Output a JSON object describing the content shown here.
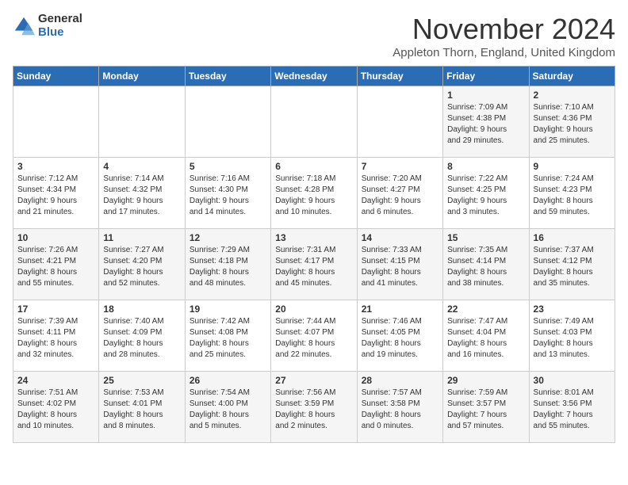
{
  "logo": {
    "general": "General",
    "blue": "Blue"
  },
  "title": "November 2024",
  "location": "Appleton Thorn, England, United Kingdom",
  "days_of_week": [
    "Sunday",
    "Monday",
    "Tuesday",
    "Wednesday",
    "Thursday",
    "Friday",
    "Saturday"
  ],
  "weeks": [
    [
      {
        "day": "",
        "info": ""
      },
      {
        "day": "",
        "info": ""
      },
      {
        "day": "",
        "info": ""
      },
      {
        "day": "",
        "info": ""
      },
      {
        "day": "",
        "info": ""
      },
      {
        "day": "1",
        "info": "Sunrise: 7:09 AM\nSunset: 4:38 PM\nDaylight: 9 hours\nand 29 minutes."
      },
      {
        "day": "2",
        "info": "Sunrise: 7:10 AM\nSunset: 4:36 PM\nDaylight: 9 hours\nand 25 minutes."
      }
    ],
    [
      {
        "day": "3",
        "info": "Sunrise: 7:12 AM\nSunset: 4:34 PM\nDaylight: 9 hours\nand 21 minutes."
      },
      {
        "day": "4",
        "info": "Sunrise: 7:14 AM\nSunset: 4:32 PM\nDaylight: 9 hours\nand 17 minutes."
      },
      {
        "day": "5",
        "info": "Sunrise: 7:16 AM\nSunset: 4:30 PM\nDaylight: 9 hours\nand 14 minutes."
      },
      {
        "day": "6",
        "info": "Sunrise: 7:18 AM\nSunset: 4:28 PM\nDaylight: 9 hours\nand 10 minutes."
      },
      {
        "day": "7",
        "info": "Sunrise: 7:20 AM\nSunset: 4:27 PM\nDaylight: 9 hours\nand 6 minutes."
      },
      {
        "day": "8",
        "info": "Sunrise: 7:22 AM\nSunset: 4:25 PM\nDaylight: 9 hours\nand 3 minutes."
      },
      {
        "day": "9",
        "info": "Sunrise: 7:24 AM\nSunset: 4:23 PM\nDaylight: 8 hours\nand 59 minutes."
      }
    ],
    [
      {
        "day": "10",
        "info": "Sunrise: 7:26 AM\nSunset: 4:21 PM\nDaylight: 8 hours\nand 55 minutes."
      },
      {
        "day": "11",
        "info": "Sunrise: 7:27 AM\nSunset: 4:20 PM\nDaylight: 8 hours\nand 52 minutes."
      },
      {
        "day": "12",
        "info": "Sunrise: 7:29 AM\nSunset: 4:18 PM\nDaylight: 8 hours\nand 48 minutes."
      },
      {
        "day": "13",
        "info": "Sunrise: 7:31 AM\nSunset: 4:17 PM\nDaylight: 8 hours\nand 45 minutes."
      },
      {
        "day": "14",
        "info": "Sunrise: 7:33 AM\nSunset: 4:15 PM\nDaylight: 8 hours\nand 41 minutes."
      },
      {
        "day": "15",
        "info": "Sunrise: 7:35 AM\nSunset: 4:14 PM\nDaylight: 8 hours\nand 38 minutes."
      },
      {
        "day": "16",
        "info": "Sunrise: 7:37 AM\nSunset: 4:12 PM\nDaylight: 8 hours\nand 35 minutes."
      }
    ],
    [
      {
        "day": "17",
        "info": "Sunrise: 7:39 AM\nSunset: 4:11 PM\nDaylight: 8 hours\nand 32 minutes."
      },
      {
        "day": "18",
        "info": "Sunrise: 7:40 AM\nSunset: 4:09 PM\nDaylight: 8 hours\nand 28 minutes."
      },
      {
        "day": "19",
        "info": "Sunrise: 7:42 AM\nSunset: 4:08 PM\nDaylight: 8 hours\nand 25 minutes."
      },
      {
        "day": "20",
        "info": "Sunrise: 7:44 AM\nSunset: 4:07 PM\nDaylight: 8 hours\nand 22 minutes."
      },
      {
        "day": "21",
        "info": "Sunrise: 7:46 AM\nSunset: 4:05 PM\nDaylight: 8 hours\nand 19 minutes."
      },
      {
        "day": "22",
        "info": "Sunrise: 7:47 AM\nSunset: 4:04 PM\nDaylight: 8 hours\nand 16 minutes."
      },
      {
        "day": "23",
        "info": "Sunrise: 7:49 AM\nSunset: 4:03 PM\nDaylight: 8 hours\nand 13 minutes."
      }
    ],
    [
      {
        "day": "24",
        "info": "Sunrise: 7:51 AM\nSunset: 4:02 PM\nDaylight: 8 hours\nand 10 minutes."
      },
      {
        "day": "25",
        "info": "Sunrise: 7:53 AM\nSunset: 4:01 PM\nDaylight: 8 hours\nand 8 minutes."
      },
      {
        "day": "26",
        "info": "Sunrise: 7:54 AM\nSunset: 4:00 PM\nDaylight: 8 hours\nand 5 minutes."
      },
      {
        "day": "27",
        "info": "Sunrise: 7:56 AM\nSunset: 3:59 PM\nDaylight: 8 hours\nand 2 minutes."
      },
      {
        "day": "28",
        "info": "Sunrise: 7:57 AM\nSunset: 3:58 PM\nDaylight: 8 hours\nand 0 minutes."
      },
      {
        "day": "29",
        "info": "Sunrise: 7:59 AM\nSunset: 3:57 PM\nDaylight: 7 hours\nand 57 minutes."
      },
      {
        "day": "30",
        "info": "Sunrise: 8:01 AM\nSunset: 3:56 PM\nDaylight: 7 hours\nand 55 minutes."
      }
    ]
  ]
}
